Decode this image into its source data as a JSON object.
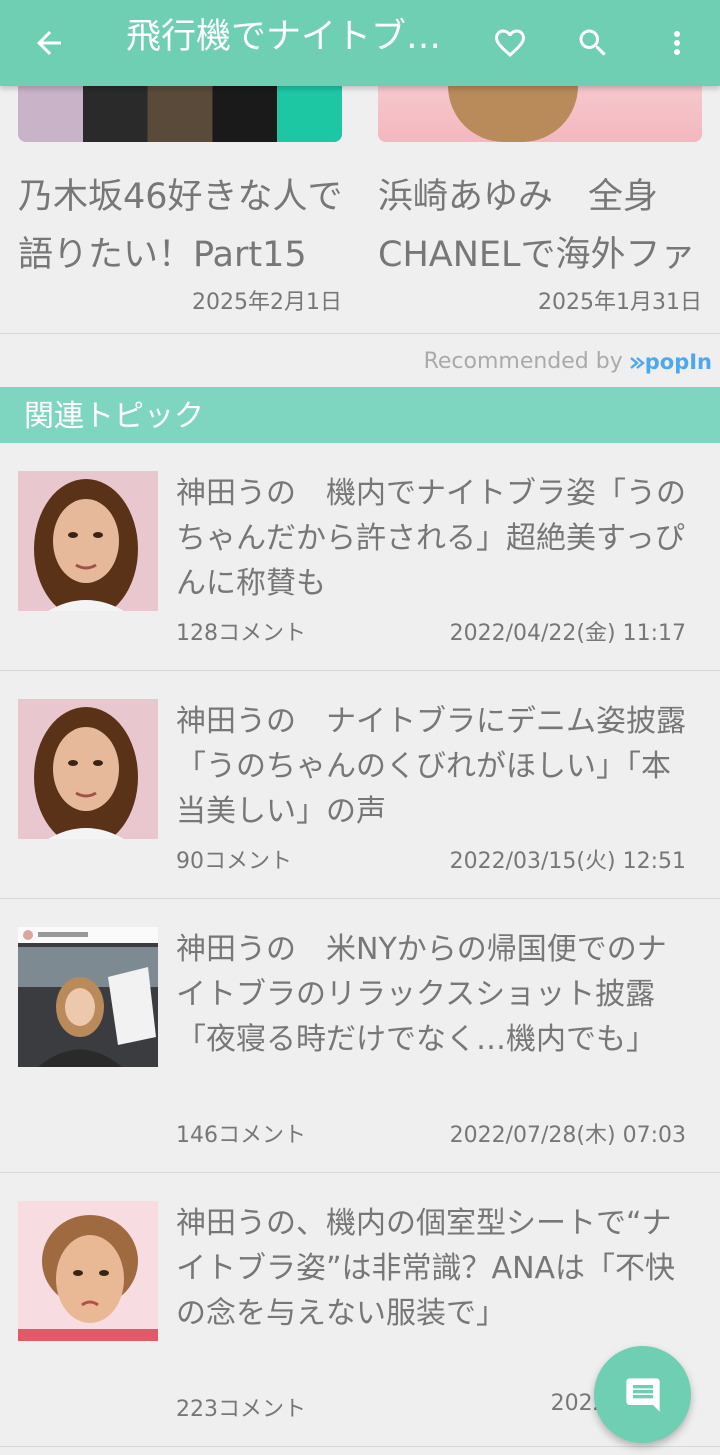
{
  "appbar": {
    "title": "飛行機でナイトブラ…",
    "back_icon": "arrow-left-icon",
    "favorite_icon": "heart-outline-icon",
    "search_icon": "search-icon",
    "more_icon": "more-vert-icon"
  },
  "recommendations": [
    {
      "title": "乃木坂46好きな人で語りたい！Part15",
      "date": "2025年2月1日"
    },
    {
      "title": "浜崎あゆみ　全身CHANELで海外ファ",
      "date": "2025年1月31日"
    }
  ],
  "recommended_by": {
    "label": "Recommended by",
    "brand": "popIn"
  },
  "related": {
    "header": "関連トピック",
    "items": [
      {
        "title": "神田うの　機内でナイトブラ姿「うのちゃんだから許される」超絶美すっぴんに称賛も",
        "comments": "128コメント",
        "date": "2022/04/22(金) 11:17"
      },
      {
        "title": "神田うの　ナイトブラにデニム姿披露「うのちゃんのくびれがほしい」「本当美しい」の声",
        "comments": "90コメント",
        "date": "2022/03/15(火) 12:51"
      },
      {
        "title": "神田うの　米NYからの帰国便でのナイトブラのリラックスショット披露「夜寝る時だけでなく…機内でも」",
        "comments": "146コメント",
        "date": "2022/07/28(木) 07:03"
      },
      {
        "title": "神田うの、機内の個室型シートで“ナイトブラ姿”は非常識？ANAは「不快の念を与えない服装で」",
        "comments": "223コメント",
        "date": "2022/08/12("
      }
    ]
  },
  "fab": {
    "icon": "comment-icon"
  },
  "colors": {
    "accent": "#6fcfb3",
    "section_header": "#7fd6c0",
    "background": "#efefef",
    "text": "#777777"
  }
}
